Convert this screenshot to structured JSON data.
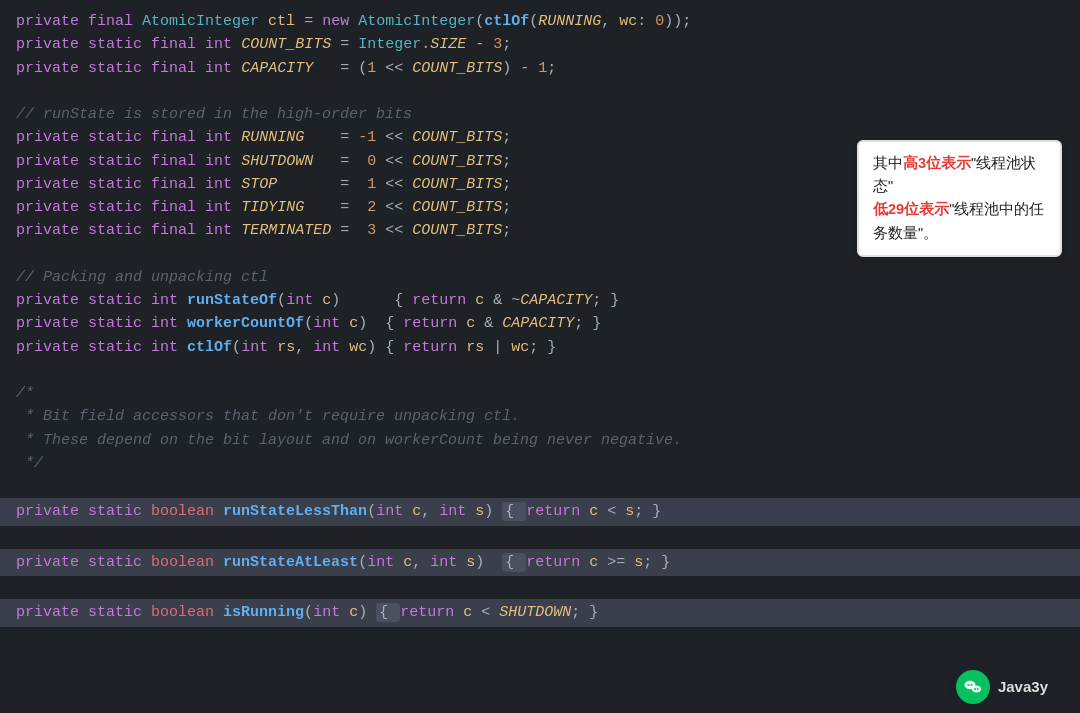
{
  "popup": {
    "text1": "其中",
    "red1": "高3位表示",
    "text2": "\"线程池状态\"",
    "text3": "",
    "red2": "低29位表示",
    "text4": "\"线程池中的任务数量\"。"
  },
  "wechat": {
    "label": "Java3y"
  },
  "code": {
    "lines": [
      "private final AtomicInteger ctl = new AtomicInteger(ctlOf(RUNNING, wc: 0));",
      "private static final int COUNT_BITS = Integer.SIZE - 3;",
      "private static final int CAPACITY   = (1 << COUNT_BITS) - 1;",
      "",
      "// runState is stored in the high-order bits",
      "private static final int RUNNING    = -1 << COUNT_BITS;",
      "private static final int SHUTDOWN   =  0 << COUNT_BITS;",
      "private static final int STOP       =  1 << COUNT_BITS;",
      "private static final int TIDYING    =  2 << COUNT_BITS;",
      "private static final int TERMINATED =  3 << COUNT_BITS;",
      "",
      "// Packing and unpacking ctl",
      "private static int runStateOf(int c)      { return c & ~CAPACITY; }",
      "private static int workerCountOf(int c)  { return c & CAPACITY; }",
      "private static int ctlOf(int rs, int wc) { return rs | wc; }",
      "",
      "/*",
      " * Bit field accessors that don't require unpacking ctl.",
      " * These depend on the bit layout and on workerCount being never negative.",
      " */",
      "",
      "private static boolean runStateLessThan(int c, int s) { return c < s; }",
      "",
      "private static boolean runStateAtLeast(int c, int s)  { return c >= s; }",
      "",
      "private static boolean isRunning(int c) { return c < SHUTDOWN; }"
    ]
  }
}
